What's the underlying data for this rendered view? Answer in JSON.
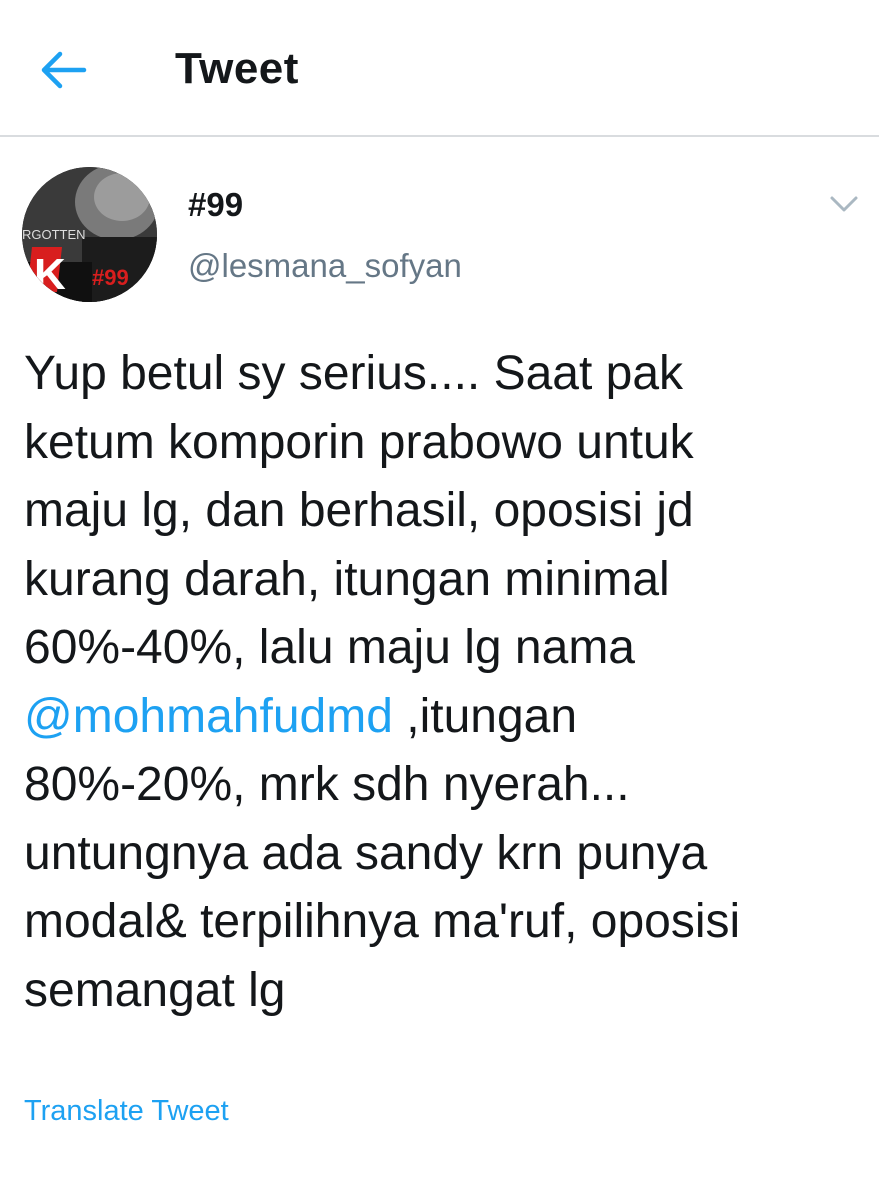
{
  "header": {
    "title": "Tweet",
    "back_icon": "arrow-left-icon",
    "accent_color": "#1da1f2"
  },
  "tweet": {
    "display_name": "#99",
    "handle": "@lesmana_sofyan",
    "avatar": {
      "overlay_text_1": "RGOTTEN",
      "overlay_text_2": "#99"
    },
    "menu_icon": "chevron-down-icon",
    "text_part_1": "Yup betul sy serius.... Saat pak\nketum komporin prabowo untuk\nmaju lg, dan berhasil, oposisi jd\nkurang darah, itungan minimal\n60%-40%, lalu maju lg nama\n",
    "mention": "@mohmahfudmd",
    "text_part_2": " ,itungan\n80%-20%, mrk sdh nyerah...\nuntungnya ada sandy krn punya\nmodal& terpilihnya ma'ruf, oposisi\nsemangat lg",
    "translate_label": "Translate Tweet"
  }
}
